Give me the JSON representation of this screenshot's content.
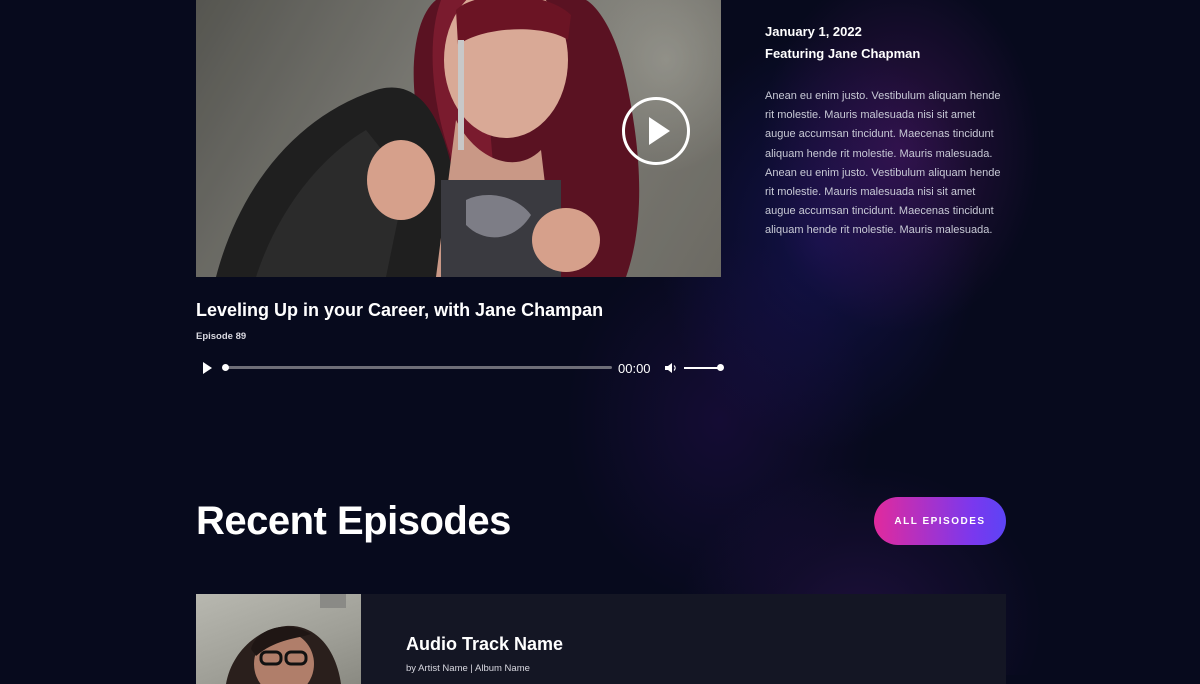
{
  "featured": {
    "date": "January 1, 2022",
    "featuring": "Featuring Jane Chapman",
    "description": "Anean eu enim justo. Vestibulum aliquam hende rit molestie. Mauris malesuada nisi sit amet augue accumsan tincidunt. Maecenas tincidunt aliquam hende rit molestie. Mauris malesuada. Anean eu enim justo. Vestibulum aliquam hende rit molestie. Mauris malesuada nisi sit amet augue accumsan tincidunt. Maecenas tincidunt aliquam hende rit molestie. Mauris malesuada.",
    "title": "Leveling Up in your Career, with Jane Champan",
    "episode_number": "Episode 89",
    "player": {
      "time": "00:00",
      "progress": 0,
      "volume": 1.0
    }
  },
  "recent": {
    "heading": "Recent Episodes",
    "button_label": "ALL EPISODES",
    "episodes": [
      {
        "title": "Audio Track Name",
        "subtitle": "by Artist Name | Album Name"
      }
    ]
  },
  "colors": {
    "background": "#070a1d",
    "button_gradient_start": "#e12a9d",
    "button_gradient_end": "#5c44f5",
    "card_background": "#141624"
  },
  "icons": {
    "video_play": "play-circle-icon",
    "audio_play": "play-icon",
    "volume": "speaker-icon"
  }
}
